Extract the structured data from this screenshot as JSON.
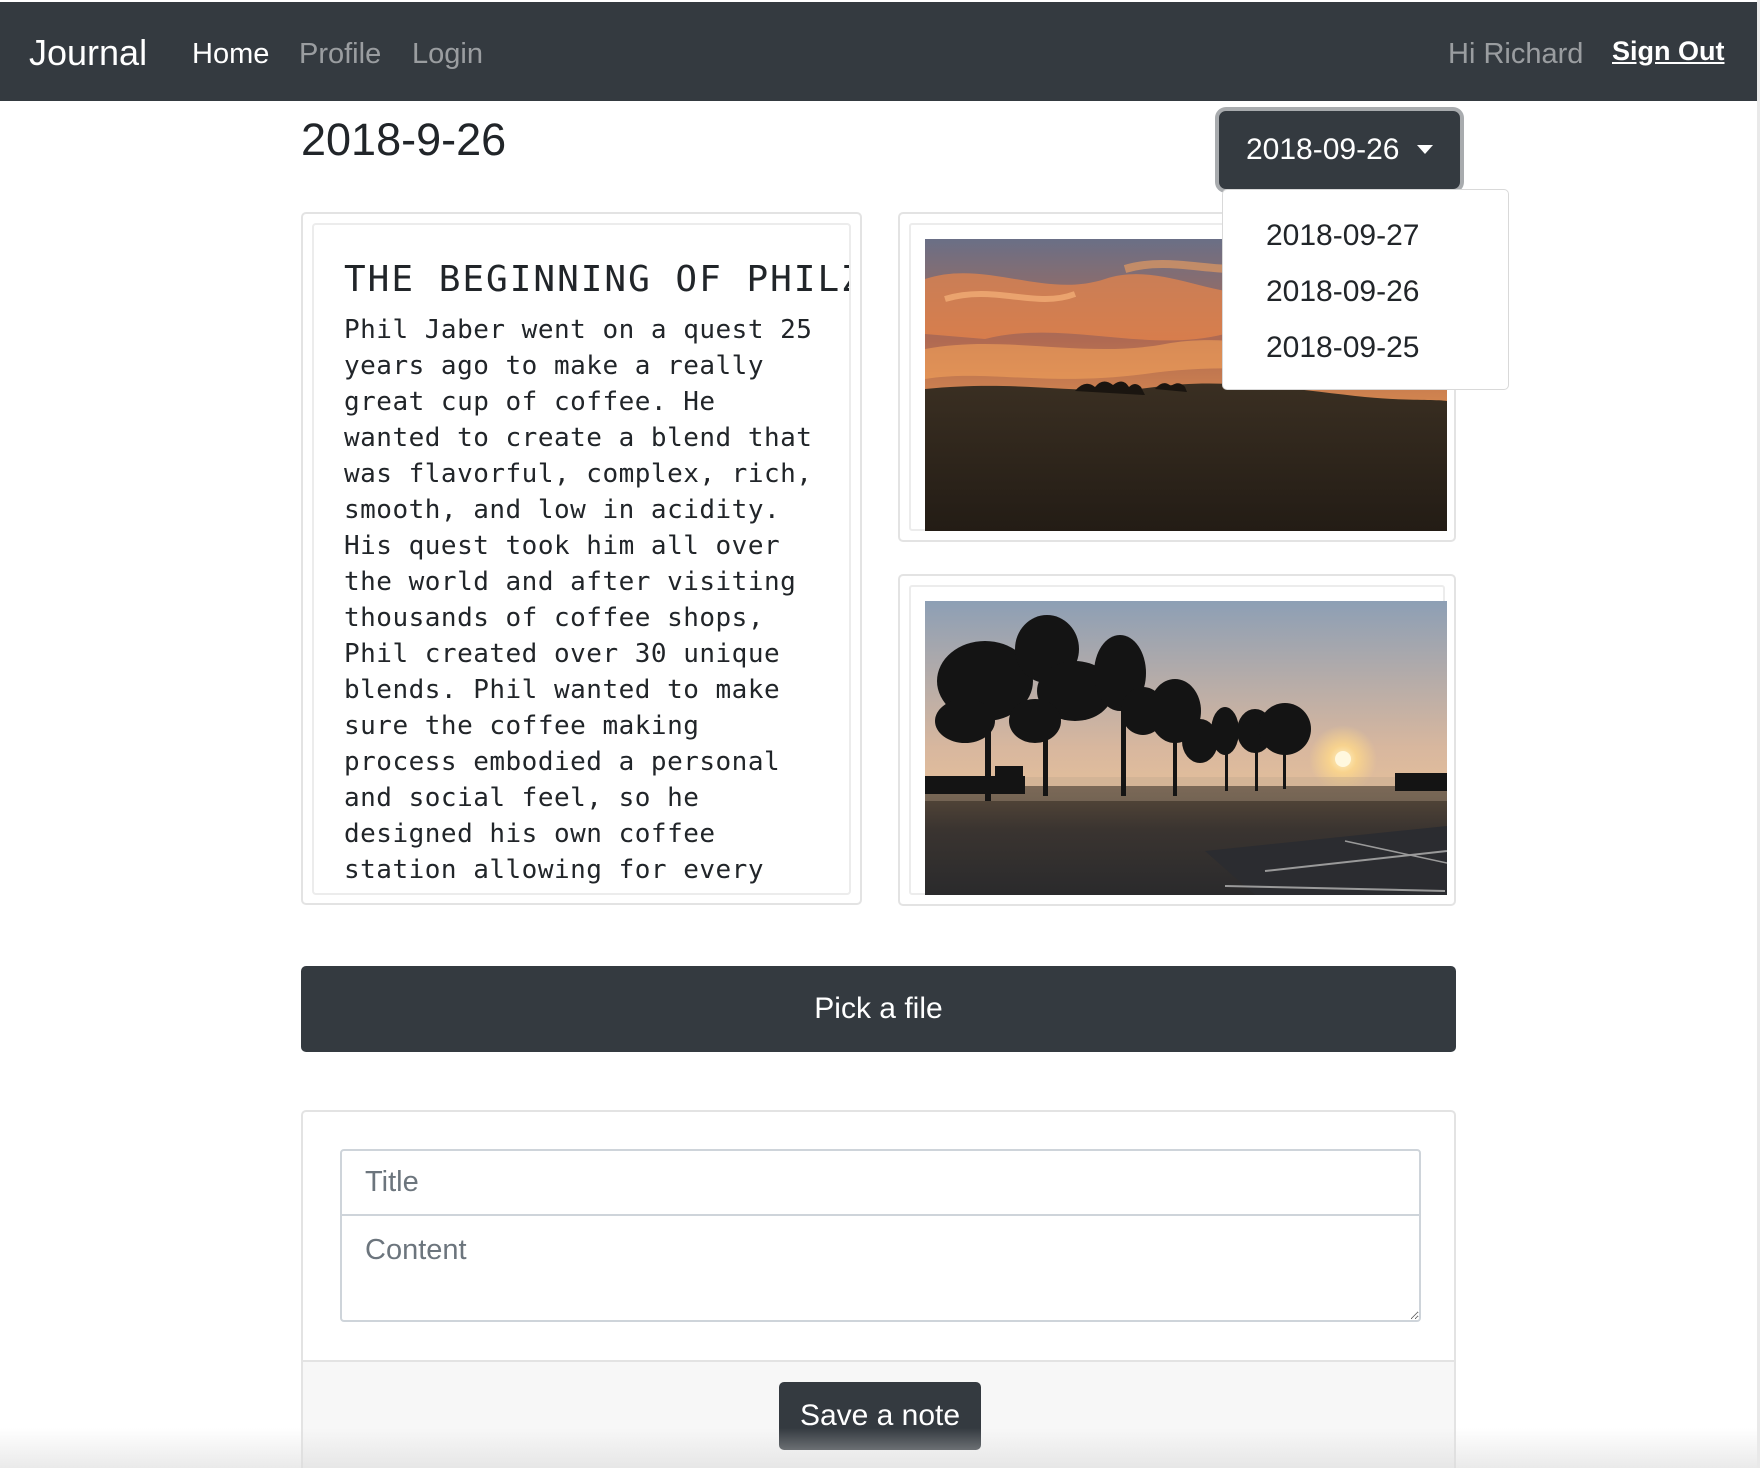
{
  "navbar": {
    "brand": "Journal",
    "links": [
      {
        "label": "Home",
        "active": true
      },
      {
        "label": "Profile",
        "active": false
      },
      {
        "label": "Login",
        "active": false
      }
    ],
    "greeting": "Hi Richard",
    "sign_out": "Sign Out"
  },
  "page": {
    "date_heading": "2018-9-26"
  },
  "date_dropdown": {
    "selected": "2018-09-26",
    "options": [
      "2018-09-27",
      "2018-09-26",
      "2018-09-25"
    ]
  },
  "note": {
    "title": "THE BEGINNING OF PHILZ",
    "body": "Phil Jaber went on a quest 25 years ago to make a really great cup of coffee. He wanted to create a blend that was flavorful, complex, rich, smooth, and low in acidity. His quest took him all over the world and after visiting thousands of coffee shops, Phil created over 30 unique blends. Phil wanted to make sure the coffee making process embodied a personal and social feel, so he designed his own coffee station allowing for every cup to be crafted one cup at a time. By personalizing each"
  },
  "images": [
    {
      "subject": "sunset-sky-over-hillside"
    },
    {
      "subject": "sunrise-trees-foggy-park"
    }
  ],
  "upload": {
    "pick_label": "Pick a file"
  },
  "form": {
    "title_placeholder": "Title",
    "content_placeholder": "Content",
    "save_label": "Save a note"
  },
  "colors": {
    "navbar_bg": "#343a40",
    "button_bg": "#343a40",
    "page_bg": "#ffffff"
  }
}
